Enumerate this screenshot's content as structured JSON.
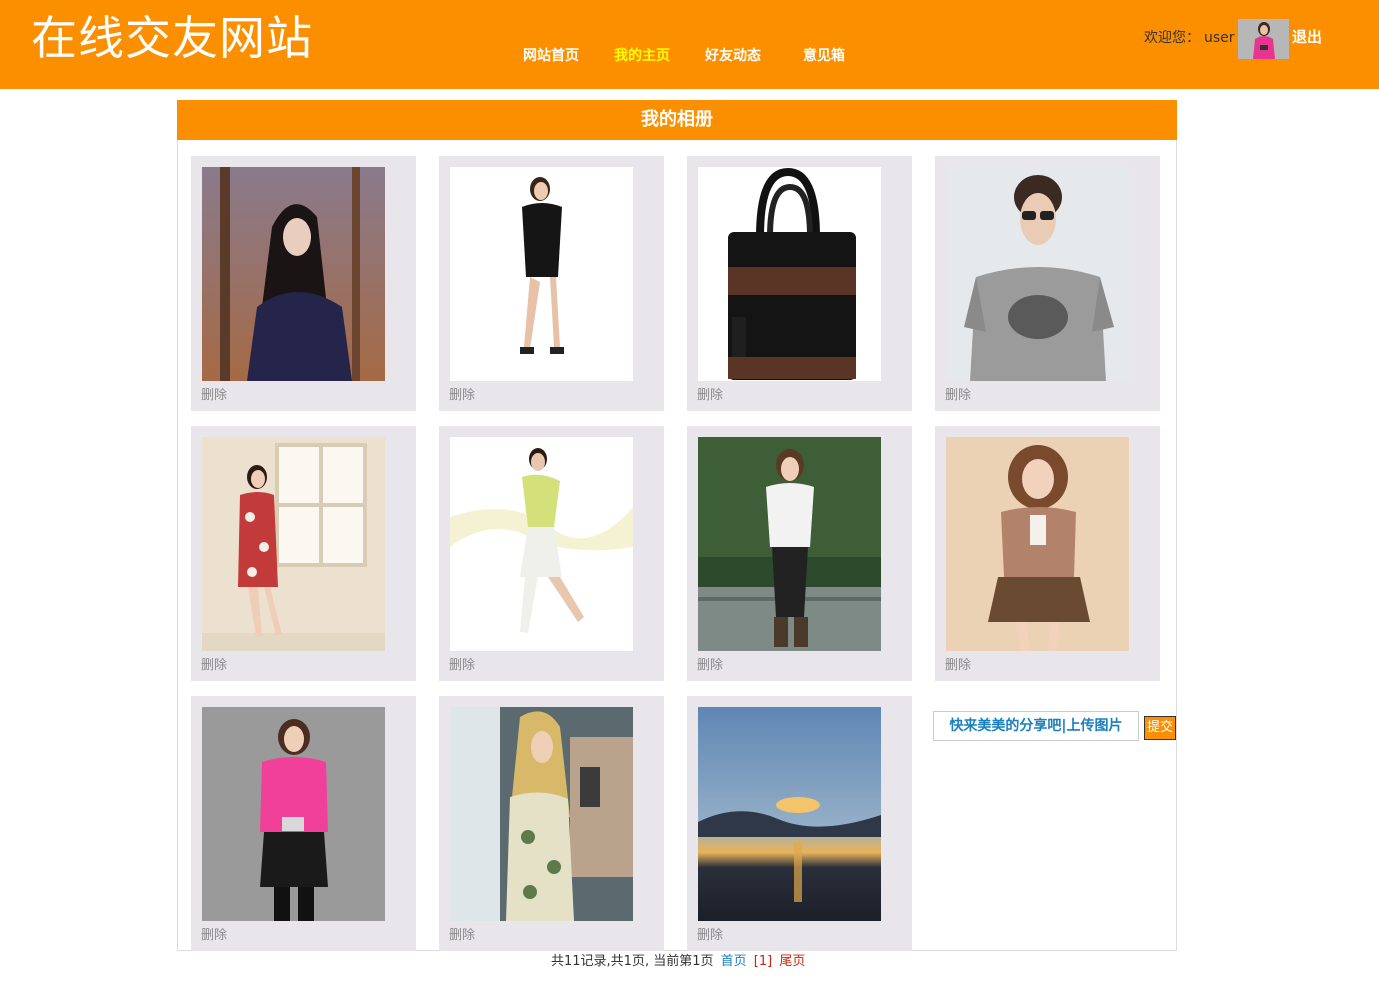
{
  "header": {
    "site_title": "在线交友网站",
    "nav": [
      {
        "label": "网站首页",
        "active": false
      },
      {
        "label": "我的主页",
        "active": true
      },
      {
        "label": "好友动态",
        "active": false
      },
      {
        "label": "意见箱",
        "active": false
      }
    ],
    "welcome_label": "欢迎您：",
    "username": "user",
    "logout_label": "退出"
  },
  "album": {
    "title": "我的相册",
    "photos": [
      {
        "subject": "woman-forest-portrait",
        "delete_label": "删除"
      },
      {
        "subject": "woman-black-dress",
        "delete_label": "删除"
      },
      {
        "subject": "leather-handbag",
        "delete_label": "删除"
      },
      {
        "subject": "man-sunglasses-tshirt",
        "delete_label": "删除"
      },
      {
        "subject": "woman-floral-dress-window",
        "delete_label": "删除"
      },
      {
        "subject": "woman-yellow-top-posing",
        "delete_label": "删除"
      },
      {
        "subject": "woman-white-sweater-garden",
        "delete_label": "删除"
      },
      {
        "subject": "woman-brown-ruffle-dress",
        "delete_label": "删除"
      },
      {
        "subject": "woman-pink-coat",
        "delete_label": "删除"
      },
      {
        "subject": "woman-blonde-floral-blur",
        "delete_label": "删除"
      },
      {
        "subject": "sunset-lake-landscape",
        "delete_label": "删除"
      }
    ],
    "upload_label": "快来美美的分享吧|上传图片",
    "submit_label": "提交"
  },
  "pager": {
    "summary": "共11记录,共1页, 当前第1页",
    "first_label": "首页",
    "current_page": "[1]",
    "last_label": "尾页"
  },
  "colors": {
    "accent": "#fb8f00",
    "nav_active": "#ffff00",
    "card_bg": "#e8e6ea",
    "link": "#1a7fbf",
    "pager_red": "#d81e06"
  }
}
